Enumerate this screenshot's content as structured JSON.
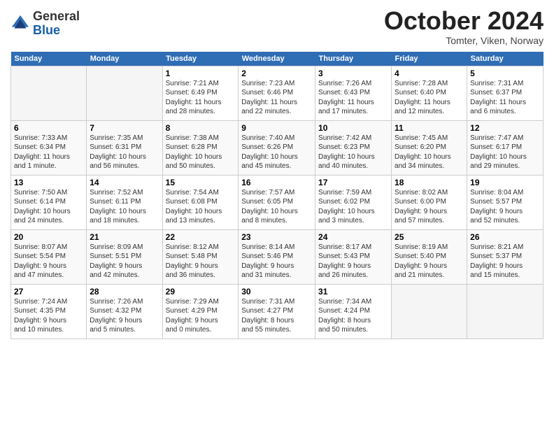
{
  "logo": {
    "general": "General",
    "blue": "Blue"
  },
  "title": "October 2024",
  "location": "Tomter, Viken, Norway",
  "headers": [
    "Sunday",
    "Monday",
    "Tuesday",
    "Wednesday",
    "Thursday",
    "Friday",
    "Saturday"
  ],
  "weeks": [
    [
      {
        "day": "",
        "detail": ""
      },
      {
        "day": "",
        "detail": ""
      },
      {
        "day": "1",
        "detail": "Sunrise: 7:21 AM\nSunset: 6:49 PM\nDaylight: 11 hours\nand 28 minutes."
      },
      {
        "day": "2",
        "detail": "Sunrise: 7:23 AM\nSunset: 6:46 PM\nDaylight: 11 hours\nand 22 minutes."
      },
      {
        "day": "3",
        "detail": "Sunrise: 7:26 AM\nSunset: 6:43 PM\nDaylight: 11 hours\nand 17 minutes."
      },
      {
        "day": "4",
        "detail": "Sunrise: 7:28 AM\nSunset: 6:40 PM\nDaylight: 11 hours\nand 12 minutes."
      },
      {
        "day": "5",
        "detail": "Sunrise: 7:31 AM\nSunset: 6:37 PM\nDaylight: 11 hours\nand 6 minutes."
      }
    ],
    [
      {
        "day": "6",
        "detail": "Sunrise: 7:33 AM\nSunset: 6:34 PM\nDaylight: 11 hours\nand 1 minute."
      },
      {
        "day": "7",
        "detail": "Sunrise: 7:35 AM\nSunset: 6:31 PM\nDaylight: 10 hours\nand 56 minutes."
      },
      {
        "day": "8",
        "detail": "Sunrise: 7:38 AM\nSunset: 6:28 PM\nDaylight: 10 hours\nand 50 minutes."
      },
      {
        "day": "9",
        "detail": "Sunrise: 7:40 AM\nSunset: 6:26 PM\nDaylight: 10 hours\nand 45 minutes."
      },
      {
        "day": "10",
        "detail": "Sunrise: 7:42 AM\nSunset: 6:23 PM\nDaylight: 10 hours\nand 40 minutes."
      },
      {
        "day": "11",
        "detail": "Sunrise: 7:45 AM\nSunset: 6:20 PM\nDaylight: 10 hours\nand 34 minutes."
      },
      {
        "day": "12",
        "detail": "Sunrise: 7:47 AM\nSunset: 6:17 PM\nDaylight: 10 hours\nand 29 minutes."
      }
    ],
    [
      {
        "day": "13",
        "detail": "Sunrise: 7:50 AM\nSunset: 6:14 PM\nDaylight: 10 hours\nand 24 minutes."
      },
      {
        "day": "14",
        "detail": "Sunrise: 7:52 AM\nSunset: 6:11 PM\nDaylight: 10 hours\nand 18 minutes."
      },
      {
        "day": "15",
        "detail": "Sunrise: 7:54 AM\nSunset: 6:08 PM\nDaylight: 10 hours\nand 13 minutes."
      },
      {
        "day": "16",
        "detail": "Sunrise: 7:57 AM\nSunset: 6:05 PM\nDaylight: 10 hours\nand 8 minutes."
      },
      {
        "day": "17",
        "detail": "Sunrise: 7:59 AM\nSunset: 6:02 PM\nDaylight: 10 hours\nand 3 minutes."
      },
      {
        "day": "18",
        "detail": "Sunrise: 8:02 AM\nSunset: 6:00 PM\nDaylight: 9 hours\nand 57 minutes."
      },
      {
        "day": "19",
        "detail": "Sunrise: 8:04 AM\nSunset: 5:57 PM\nDaylight: 9 hours\nand 52 minutes."
      }
    ],
    [
      {
        "day": "20",
        "detail": "Sunrise: 8:07 AM\nSunset: 5:54 PM\nDaylight: 9 hours\nand 47 minutes."
      },
      {
        "day": "21",
        "detail": "Sunrise: 8:09 AM\nSunset: 5:51 PM\nDaylight: 9 hours\nand 42 minutes."
      },
      {
        "day": "22",
        "detail": "Sunrise: 8:12 AM\nSunset: 5:48 PM\nDaylight: 9 hours\nand 36 minutes."
      },
      {
        "day": "23",
        "detail": "Sunrise: 8:14 AM\nSunset: 5:46 PM\nDaylight: 9 hours\nand 31 minutes."
      },
      {
        "day": "24",
        "detail": "Sunrise: 8:17 AM\nSunset: 5:43 PM\nDaylight: 9 hours\nand 26 minutes."
      },
      {
        "day": "25",
        "detail": "Sunrise: 8:19 AM\nSunset: 5:40 PM\nDaylight: 9 hours\nand 21 minutes."
      },
      {
        "day": "26",
        "detail": "Sunrise: 8:21 AM\nSunset: 5:37 PM\nDaylight: 9 hours\nand 15 minutes."
      }
    ],
    [
      {
        "day": "27",
        "detail": "Sunrise: 7:24 AM\nSunset: 4:35 PM\nDaylight: 9 hours\nand 10 minutes."
      },
      {
        "day": "28",
        "detail": "Sunrise: 7:26 AM\nSunset: 4:32 PM\nDaylight: 9 hours\nand 5 minutes."
      },
      {
        "day": "29",
        "detail": "Sunrise: 7:29 AM\nSunset: 4:29 PM\nDaylight: 9 hours\nand 0 minutes."
      },
      {
        "day": "30",
        "detail": "Sunrise: 7:31 AM\nSunset: 4:27 PM\nDaylight: 8 hours\nand 55 minutes."
      },
      {
        "day": "31",
        "detail": "Sunrise: 7:34 AM\nSunset: 4:24 PM\nDaylight: 8 hours\nand 50 minutes."
      },
      {
        "day": "",
        "detail": ""
      },
      {
        "day": "",
        "detail": ""
      }
    ]
  ]
}
